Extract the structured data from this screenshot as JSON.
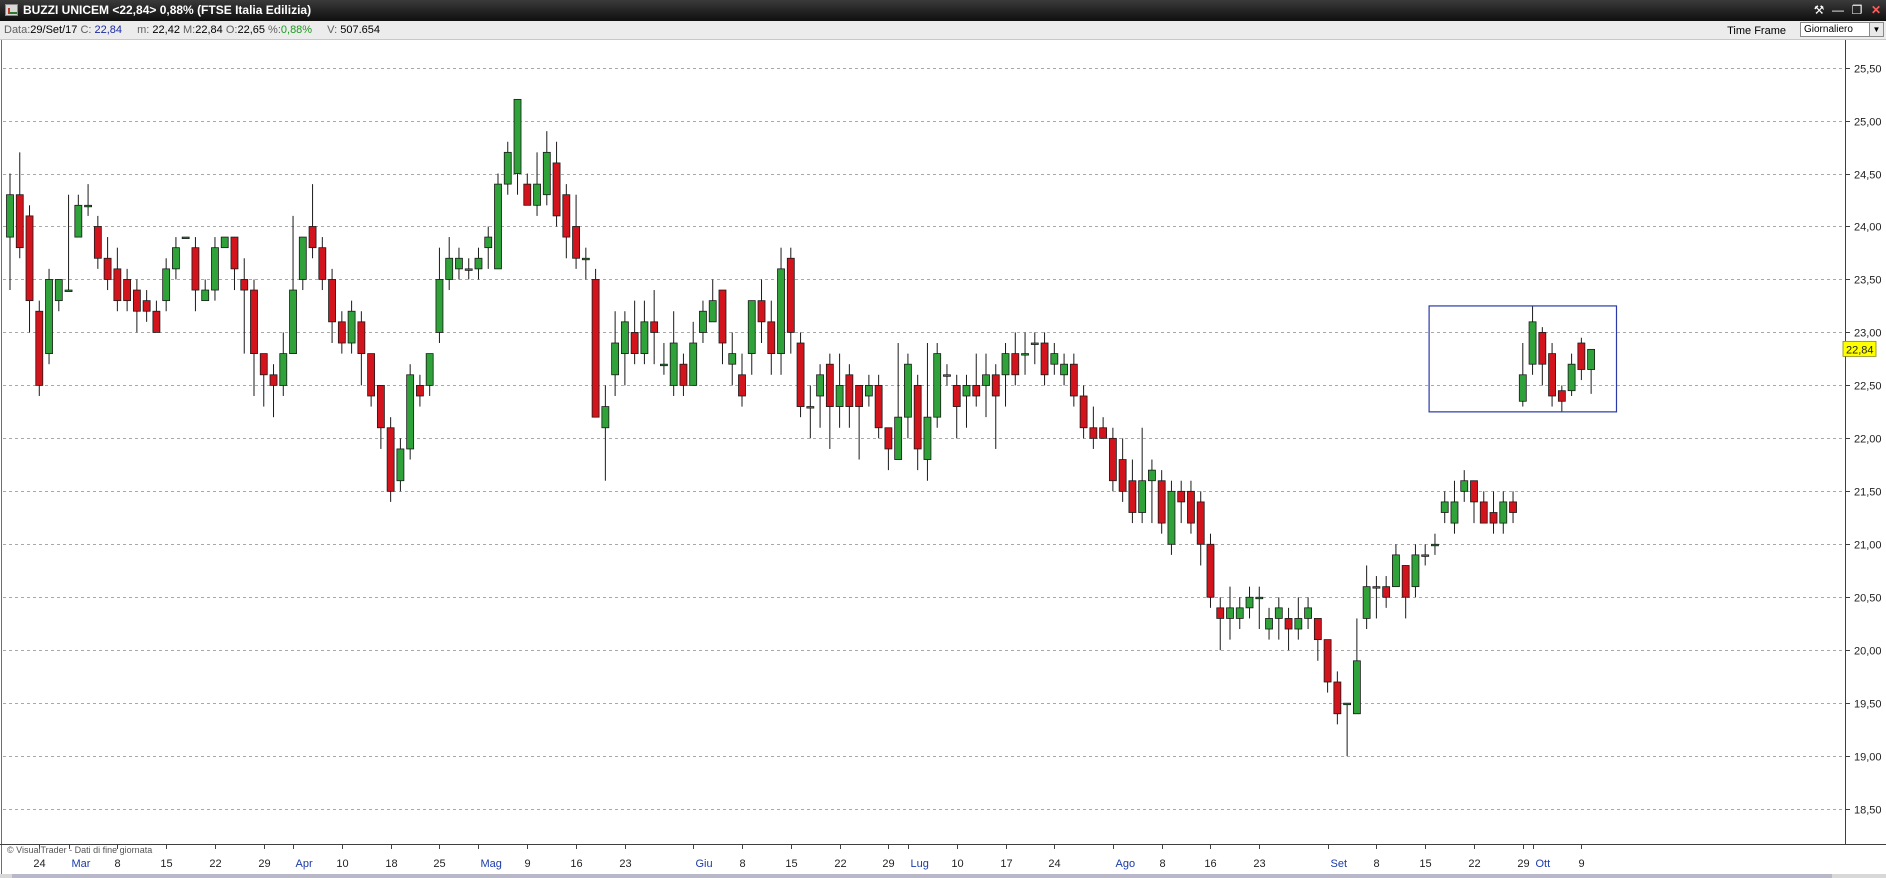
{
  "window": {
    "title": "BUZZI UNICEM <22,84> 0,88%  (FTSE Italia Edilizia)",
    "controls": [
      "⚒",
      "—",
      "❐",
      "✕"
    ]
  },
  "info": {
    "date_label": "Data:",
    "date": "29/Set/17",
    "close_label": "C:",
    "close": "22,84",
    "low_label": "m:",
    "low": "22,42",
    "high_label": "M:",
    "high": "22,84",
    "open_label": "O:",
    "open": "22,65",
    "pct_label": "%:",
    "pct": "0,88%",
    "volume_label": "V:",
    "volume": "507.654"
  },
  "timeframe": {
    "label": "Time Frame",
    "value": "Giornaliero"
  },
  "footer": {
    "copyright": "© VisualTrader - Dati di fine giornata"
  },
  "colors": {
    "up": "#2fa23a",
    "down": "#d3141d",
    "grid": "#a8a8a8",
    "month_label": "#1a3aa8",
    "price_tag_bg": "#ffff00",
    "box": "#2b3aa8"
  },
  "chart_data": {
    "type": "candlestick",
    "y_range": [
      18.35,
      25.6
    ],
    "y_ticks": [
      "18,50",
      "19,00",
      "19,50",
      "20,00",
      "20,50",
      "21,00",
      "21,50",
      "22,00",
      "22,50",
      "23,00",
      "23,50",
      "24,00",
      "24,50",
      "25,00",
      "25,50"
    ],
    "x_labels": [
      {
        "text": "24",
        "idx": 3,
        "month": false
      },
      {
        "text": "Mar",
        "idx": 6,
        "month": true
      },
      {
        "text": "8",
        "idx": 11,
        "month": false
      },
      {
        "text": "15",
        "idx": 16,
        "month": false
      },
      {
        "text": "22",
        "idx": 21,
        "month": false
      },
      {
        "text": "29",
        "idx": 26,
        "month": false
      },
      {
        "text": "Apr",
        "idx": 29,
        "month": true
      },
      {
        "text": "10",
        "idx": 34,
        "month": false
      },
      {
        "text": "18",
        "idx": 39,
        "month": false
      },
      {
        "text": "25",
        "idx": 44,
        "month": false
      },
      {
        "text": "Mag",
        "idx": 48,
        "month": true
      },
      {
        "text": "9",
        "idx": 53,
        "month": false
      },
      {
        "text": "16",
        "idx": 58,
        "month": false
      },
      {
        "text": "23",
        "idx": 63,
        "month": false
      },
      {
        "text": "Giu",
        "idx": 70,
        "month": true
      },
      {
        "text": "8",
        "idx": 75,
        "month": false
      },
      {
        "text": "15",
        "idx": 80,
        "month": false
      },
      {
        "text": "22",
        "idx": 85,
        "month": false
      },
      {
        "text": "29",
        "idx": 90,
        "month": false
      },
      {
        "text": "Lug",
        "idx": 92,
        "month": true
      },
      {
        "text": "10",
        "idx": 97,
        "month": false
      },
      {
        "text": "17",
        "idx": 102,
        "month": false
      },
      {
        "text": "24",
        "idx": 107,
        "month": false
      },
      {
        "text": "Ago",
        "idx": 113,
        "month": true
      },
      {
        "text": "8",
        "idx": 118,
        "month": false
      },
      {
        "text": "16",
        "idx": 123,
        "month": false
      },
      {
        "text": "23",
        "idx": 128,
        "month": false
      },
      {
        "text": "Set",
        "idx": 135,
        "month": true
      },
      {
        "text": "8",
        "idx": 140,
        "month": false
      },
      {
        "text": "15",
        "idx": 145,
        "month": false
      },
      {
        "text": "22",
        "idx": 150,
        "month": false
      },
      {
        "text": "29",
        "idx": 155,
        "month": false
      },
      {
        "text": "Ott",
        "idx": 156,
        "month": true
      },
      {
        "text": "9",
        "idx": 161,
        "month": false
      }
    ],
    "last_price": "22,84",
    "highlight_box": {
      "from_idx": 145.4,
      "to_idx": 164.6,
      "top": 23.25,
      "bottom": 22.25
    },
    "candles": [
      [
        23.9,
        24.3,
        24.5,
        23.4
      ],
      [
        24.3,
        23.8,
        24.7,
        23.7
      ],
      [
        24.1,
        23.3,
        24.2,
        23.0
      ],
      [
        23.2,
        22.5,
        23.3,
        22.4
      ],
      [
        22.8,
        23.5,
        23.6,
        22.7
      ],
      [
        23.3,
        23.5,
        23.5,
        23.2
      ],
      [
        23.4,
        23.4,
        24.3,
        23.4
      ],
      [
        23.9,
        24.2,
        24.3,
        23.9
      ],
      [
        24.2,
        24.2,
        24.4,
        24.1
      ],
      [
        24.0,
        23.7,
        24.1,
        23.6
      ],
      [
        23.7,
        23.5,
        23.9,
        23.4
      ],
      [
        23.6,
        23.3,
        23.8,
        23.2
      ],
      [
        23.5,
        23.3,
        23.6,
        23.2
      ],
      [
        23.4,
        23.2,
        23.5,
        23.0
      ],
      [
        23.3,
        23.2,
        23.4,
        23.1
      ],
      [
        23.2,
        23.0,
        23.3,
        23.0
      ],
      [
        23.3,
        23.6,
        23.7,
        23.2
      ],
      [
        23.6,
        23.8,
        23.9,
        23.5
      ],
      [
        23.9,
        23.9,
        23.9,
        23.9
      ],
      [
        23.8,
        23.4,
        23.9,
        23.2
      ],
      [
        23.3,
        23.4,
        23.5,
        23.3
      ],
      [
        23.4,
        23.8,
        23.9,
        23.3
      ],
      [
        23.8,
        23.9,
        23.9,
        23.8
      ],
      [
        23.9,
        23.6,
        23.9,
        23.4
      ],
      [
        23.5,
        23.4,
        23.7,
        22.8
      ],
      [
        23.4,
        22.8,
        23.5,
        22.4
      ],
      [
        22.8,
        22.6,
        22.8,
        22.3
      ],
      [
        22.6,
        22.5,
        22.7,
        22.2
      ],
      [
        22.5,
        22.8,
        23.0,
        22.4
      ],
      [
        22.8,
        23.4,
        24.1,
        22.8
      ],
      [
        23.5,
        23.9,
        23.9,
        23.4
      ],
      [
        24.0,
        23.8,
        24.4,
        23.7
      ],
      [
        23.8,
        23.5,
        23.9,
        23.4
      ],
      [
        23.5,
        23.1,
        23.6,
        22.9
      ],
      [
        23.1,
        22.9,
        23.2,
        22.8
      ],
      [
        22.9,
        23.2,
        23.3,
        22.8
      ],
      [
        23.1,
        22.8,
        23.2,
        22.5
      ],
      [
        22.8,
        22.4,
        22.8,
        22.3
      ],
      [
        22.5,
        22.1,
        22.5,
        21.9
      ],
      [
        22.1,
        21.5,
        22.2,
        21.4
      ],
      [
        21.6,
        21.9,
        22.0,
        21.5
      ],
      [
        21.9,
        22.6,
        22.7,
        21.8
      ],
      [
        22.5,
        22.4,
        22.6,
        22.3
      ],
      [
        22.5,
        22.8,
        22.8,
        22.4
      ],
      [
        23.0,
        23.5,
        23.8,
        22.9
      ],
      [
        23.5,
        23.7,
        23.9,
        23.4
      ],
      [
        23.6,
        23.7,
        23.8,
        23.5
      ],
      [
        23.6,
        23.6,
        23.7,
        23.5
      ],
      [
        23.6,
        23.7,
        23.8,
        23.5
      ],
      [
        23.8,
        23.9,
        24.0,
        23.6
      ],
      [
        23.6,
        24.4,
        24.5,
        23.6
      ],
      [
        24.4,
        24.7,
        24.8,
        24.3
      ],
      [
        24.5,
        25.2,
        25.2,
        24.3
      ],
      [
        24.4,
        24.2,
        24.5,
        24.2
      ],
      [
        24.2,
        24.4,
        24.7,
        24.1
      ],
      [
        24.3,
        24.7,
        24.9,
        24.2
      ],
      [
        24.6,
        24.1,
        24.8,
        24.0
      ],
      [
        24.3,
        23.9,
        24.4,
        23.7
      ],
      [
        24.0,
        23.7,
        24.3,
        23.6
      ],
      [
        23.7,
        23.7,
        23.8,
        23.5
      ],
      [
        23.5,
        22.2,
        23.6,
        22.2
      ],
      [
        22.1,
        22.3,
        22.5,
        21.6
      ],
      [
        22.6,
        22.9,
        23.2,
        22.4
      ],
      [
        22.8,
        23.1,
        23.2,
        22.5
      ],
      [
        23.0,
        22.8,
        23.3,
        22.7
      ],
      [
        22.8,
        23.1,
        23.3,
        22.7
      ],
      [
        23.1,
        23.0,
        23.4,
        22.7
      ],
      [
        22.7,
        22.7,
        22.9,
        22.6
      ],
      [
        22.5,
        22.9,
        23.2,
        22.4
      ],
      [
        22.7,
        22.5,
        22.8,
        22.4
      ],
      [
        22.5,
        22.9,
        23.1,
        22.5
      ],
      [
        23.0,
        23.2,
        23.3,
        22.9
      ],
      [
        23.1,
        23.3,
        23.5,
        23.1
      ],
      [
        23.4,
        22.9,
        23.4,
        22.7
      ],
      [
        22.7,
        22.8,
        23.0,
        22.5
      ],
      [
        22.6,
        22.4,
        22.8,
        22.3
      ],
      [
        22.8,
        23.3,
        23.3,
        22.6
      ],
      [
        23.3,
        23.1,
        23.5,
        22.9
      ],
      [
        23.1,
        22.8,
        23.3,
        22.6
      ],
      [
        22.8,
        23.6,
        23.8,
        22.6
      ],
      [
        23.7,
        23.0,
        23.8,
        22.8
      ],
      [
        22.9,
        22.3,
        23.0,
        22.2
      ],
      [
        22.3,
        22.3,
        22.5,
        22.0
      ],
      [
        22.4,
        22.6,
        22.7,
        22.1
      ],
      [
        22.7,
        22.3,
        22.8,
        21.9
      ],
      [
        22.3,
        22.5,
        22.8,
        22.1
      ],
      [
        22.6,
        22.3,
        22.7,
        22.1
      ],
      [
        22.5,
        22.3,
        22.5,
        21.8
      ],
      [
        22.4,
        22.5,
        22.6,
        22.3
      ],
      [
        22.5,
        22.1,
        22.6,
        22.0
      ],
      [
        22.1,
        21.9,
        22.1,
        21.7
      ],
      [
        21.8,
        22.2,
        22.9,
        21.8
      ],
      [
        22.2,
        22.7,
        22.8,
        22.0
      ],
      [
        22.5,
        21.9,
        22.6,
        21.7
      ],
      [
        21.8,
        22.2,
        22.9,
        21.6
      ],
      [
        22.2,
        22.8,
        22.9,
        22.1
      ],
      [
        22.6,
        22.6,
        22.7,
        22.5
      ],
      [
        22.5,
        22.3,
        22.6,
        22.0
      ],
      [
        22.4,
        22.5,
        22.6,
        22.1
      ],
      [
        22.5,
        22.4,
        22.8,
        22.3
      ],
      [
        22.5,
        22.6,
        22.8,
        22.2
      ],
      [
        22.6,
        22.4,
        22.7,
        21.9
      ],
      [
        22.6,
        22.8,
        22.9,
        22.3
      ],
      [
        22.8,
        22.6,
        23.0,
        22.5
      ],
      [
        22.8,
        22.8,
        23.0,
        22.6
      ],
      [
        22.9,
        22.9,
        23.0,
        22.7
      ],
      [
        22.9,
        22.6,
        23.0,
        22.5
      ],
      [
        22.7,
        22.8,
        22.9,
        22.6
      ],
      [
        22.6,
        22.7,
        22.8,
        22.5
      ],
      [
        22.7,
        22.4,
        22.8,
        22.3
      ],
      [
        22.4,
        22.1,
        22.5,
        22.0
      ],
      [
        22.1,
        22.0,
        22.3,
        21.9
      ],
      [
        22.1,
        22.0,
        22.2,
        22.0
      ],
      [
        22.0,
        21.6,
        22.1,
        21.5
      ],
      [
        21.8,
        21.5,
        22.0,
        21.4
      ],
      [
        21.6,
        21.3,
        21.8,
        21.2
      ],
      [
        21.3,
        21.6,
        22.1,
        21.2
      ],
      [
        21.6,
        21.7,
        21.8,
        21.2
      ],
      [
        21.6,
        21.2,
        21.7,
        21.1
      ],
      [
        21.0,
        21.5,
        21.6,
        20.9
      ],
      [
        21.5,
        21.4,
        21.6,
        21.2
      ],
      [
        21.5,
        21.2,
        21.6,
        21.1
      ],
      [
        21.4,
        21.0,
        21.5,
        20.8
      ],
      [
        21.0,
        20.5,
        21.1,
        20.4
      ],
      [
        20.4,
        20.3,
        20.5,
        20.0
      ],
      [
        20.3,
        20.4,
        20.6,
        20.1
      ],
      [
        20.3,
        20.4,
        20.5,
        20.2
      ],
      [
        20.4,
        20.5,
        20.6,
        20.3
      ],
      [
        20.5,
        20.5,
        20.6,
        20.2
      ],
      [
        20.2,
        20.3,
        20.4,
        20.1
      ],
      [
        20.3,
        20.4,
        20.5,
        20.1
      ],
      [
        20.3,
        20.2,
        20.4,
        20.0
      ],
      [
        20.2,
        20.3,
        20.5,
        20.1
      ],
      [
        20.3,
        20.4,
        20.5,
        20.2
      ],
      [
        20.3,
        20.1,
        20.3,
        19.9
      ],
      [
        20.1,
        19.7,
        20.1,
        19.6
      ],
      [
        19.7,
        19.4,
        19.8,
        19.3
      ],
      [
        19.5,
        19.5,
        19.5,
        19.0
      ],
      [
        19.4,
        19.9,
        20.3,
        19.4
      ],
      [
        20.3,
        20.6,
        20.8,
        20.2
      ],
      [
        20.6,
        20.6,
        20.7,
        20.3
      ],
      [
        20.6,
        20.5,
        20.7,
        20.4
      ],
      [
        20.6,
        20.9,
        21.0,
        20.6
      ],
      [
        20.8,
        20.5,
        20.8,
        20.3
      ],
      [
        20.6,
        20.9,
        21.0,
        20.5
      ],
      [
        20.9,
        20.9,
        21.0,
        20.8
      ],
      [
        21.0,
        21.0,
        21.1,
        20.9
      ],
      [
        21.3,
        21.4,
        21.5,
        21.2
      ],
      [
        21.2,
        21.4,
        21.6,
        21.1
      ],
      [
        21.5,
        21.6,
        21.7,
        21.4
      ],
      [
        21.6,
        21.4,
        21.6,
        21.2
      ],
      [
        21.4,
        21.2,
        21.5,
        21.2
      ],
      [
        21.3,
        21.2,
        21.5,
        21.1
      ],
      [
        21.2,
        21.4,
        21.5,
        21.1
      ],
      [
        21.4,
        21.3,
        21.5,
        21.2
      ],
      [
        22.35,
        22.6,
        22.9,
        22.3
      ],
      [
        22.7,
        23.1,
        23.25,
        22.6
      ],
      [
        23.0,
        22.7,
        23.05,
        22.5
      ],
      [
        22.8,
        22.4,
        22.9,
        22.3
      ],
      [
        22.45,
        22.35,
        22.5,
        22.25
      ],
      [
        22.45,
        22.7,
        22.8,
        22.4
      ],
      [
        22.9,
        22.65,
        22.95,
        22.55
      ],
      [
        22.65,
        22.84,
        22.84,
        22.42
      ]
    ]
  }
}
